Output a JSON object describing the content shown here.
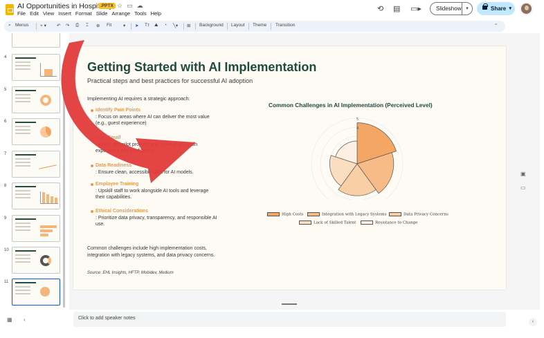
{
  "app": {
    "doc_title": "AI Opportunities in Hospitality",
    "file_badge": ".PPTX",
    "menu": [
      "File",
      "Edit",
      "View",
      "Insert",
      "Format",
      "Slide",
      "Arrange",
      "Tools",
      "Help"
    ],
    "slideshow_label": "Slideshow",
    "share_label": "Share"
  },
  "toolbar": {
    "menus_label": "Menus",
    "zoom_label": "Fit",
    "background_label": "Background",
    "layout_label": "Layout",
    "theme_label": "Theme",
    "transition_label": "Transition"
  },
  "filmstrip": {
    "slides": [
      "4",
      "5",
      "6",
      "7",
      "8",
      "9",
      "10",
      "11"
    ],
    "selected": "11"
  },
  "slide": {
    "title": "Getting Started with AI Implementation",
    "subtitle": "Practical steps and best practices for successful AI adoption",
    "intro": "Implementing AI requires a strategic approach:",
    "points": [
      {
        "heading": "Identify Pain Points",
        "text": ": Focus on areas where AI can deliver the most value (e.g., guest experience)"
      },
      {
        "heading": "Start Small",
        "text": ": Begin with pilot projects and scale as you gain experience and confidence."
      },
      {
        "heading": "Data Readiness",
        "text": ": Ensure clean, accessible data for AI models."
      },
      {
        "heading": "Employee Training",
        "text": ": Upskill staff to work alongside AI tools and leverage their capabilities."
      },
      {
        "heading": "Ethical Considerations",
        "text": ": Prioritize data privacy, transparency, and responsible AI use."
      }
    ],
    "closing": "Common challenges include high implementation costs, integration with legacy systems, and data privacy concerns.",
    "source": "Source: EHL Insights, HFTP, Mobidev, Medium"
  },
  "chart_data": {
    "type": "polar-area",
    "title": "Common Challenges in AI Implementation (Perceived Level)",
    "categories": [
      "High Costs",
      "Integration with Legacy Systems",
      "Data Privacy Concerns",
      "Lack of Skilled Talent",
      "Resistance to Change"
    ],
    "values": [
      4.5,
      4,
      3.5,
      3,
      2.5
    ],
    "colors": [
      "#f4a764",
      "#f7bb87",
      "#f9cfa6",
      "#fbddc0",
      "#fdf0e2"
    ],
    "radial_ticks": [
      "4",
      "5"
    ],
    "rmax": 5,
    "legend_position": "bottom"
  },
  "notes": {
    "placeholder": "Click to add speaker notes"
  }
}
